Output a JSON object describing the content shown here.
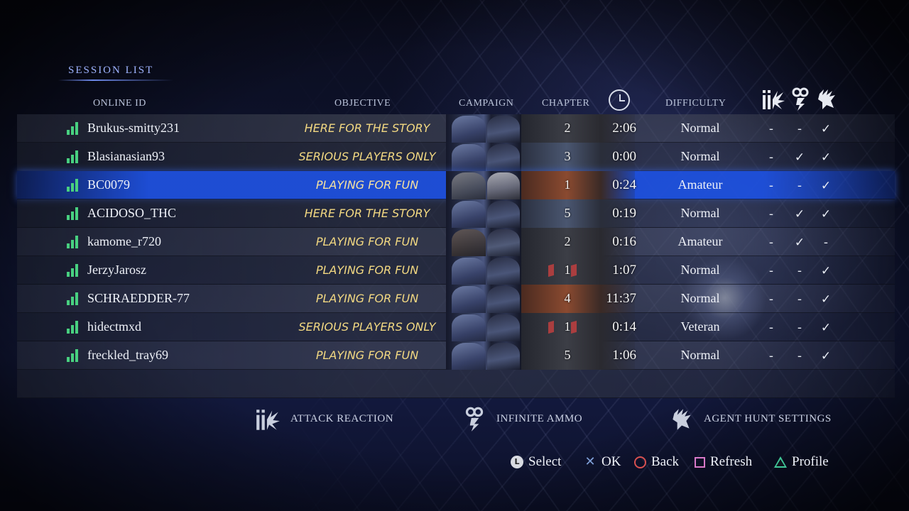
{
  "screen": {
    "title": "SESSION LIST"
  },
  "columns": {
    "online_id": "ONLINE ID",
    "objective": "OBJECTIVE",
    "campaign": "CAMPAIGN",
    "chapter": "CHAPTER",
    "time_icon": "clock-icon",
    "difficulty": "DIFFICULTY",
    "setting_icons": [
      "attack-reaction-icon",
      "infinite-ammo-icon",
      "agent-hunt-icon"
    ]
  },
  "sessions": [
    {
      "online_id": "Brukus-smitty231",
      "objective": "HERE FOR THE STORY",
      "chapter": "2",
      "time": "2:06",
      "difficulty": "Normal",
      "attack_reaction": "-",
      "infinite_ammo": "-",
      "agent_hunt": "✓",
      "signal_bars": 3
    },
    {
      "online_id": "Blasianasian93",
      "objective": "SERIOUS PLAYERS ONLY",
      "chapter": "3",
      "time": "0:00",
      "difficulty": "Normal",
      "attack_reaction": "-",
      "infinite_ammo": "✓",
      "agent_hunt": "✓",
      "signal_bars": 3
    },
    {
      "online_id": "BC0079",
      "objective": "PLAYING FOR FUN",
      "chapter": "1",
      "time": "0:24",
      "difficulty": "Amateur",
      "attack_reaction": "-",
      "infinite_ammo": "-",
      "agent_hunt": "✓",
      "signal_bars": 3,
      "selected": true
    },
    {
      "online_id": "ACIDOSO_THC",
      "objective": "HERE FOR THE STORY",
      "chapter": "5",
      "time": "0:19",
      "difficulty": "Normal",
      "attack_reaction": "-",
      "infinite_ammo": "✓",
      "agent_hunt": "✓",
      "signal_bars": 3
    },
    {
      "online_id": "kamome_r720",
      "objective": "PLAYING FOR FUN",
      "chapter": "2",
      "time": "0:16",
      "difficulty": "Amateur",
      "attack_reaction": "-",
      "infinite_ammo": "✓",
      "agent_hunt": "-",
      "signal_bars": 3
    },
    {
      "online_id": "JerzyJarosz",
      "objective": "PLAYING FOR FUN",
      "chapter": "1",
      "time": "1:07",
      "difficulty": "Normal",
      "attack_reaction": "-",
      "infinite_ammo": "-",
      "agent_hunt": "✓",
      "signal_bars": 3
    },
    {
      "online_id": "SCHRAEDDER-77",
      "objective": "PLAYING FOR FUN",
      "chapter": "4",
      "time": "11:37",
      "difficulty": "Normal",
      "attack_reaction": "-",
      "infinite_ammo": "-",
      "agent_hunt": "✓",
      "signal_bars": 3
    },
    {
      "online_id": "hidectmxd",
      "objective": "SERIOUS PLAYERS ONLY",
      "chapter": "1",
      "time": "0:14",
      "difficulty": "Veteran",
      "attack_reaction": "-",
      "infinite_ammo": "-",
      "agent_hunt": "✓",
      "signal_bars": 3
    },
    {
      "online_id": "freckled_tray69",
      "objective": "PLAYING FOR FUN",
      "chapter": "5",
      "time": "1:06",
      "difficulty": "Normal",
      "attack_reaction": "-",
      "infinite_ammo": "-",
      "agent_hunt": "✓",
      "signal_bars": 3
    }
  ],
  "legend": {
    "attack_reaction": "ATTACK REACTION",
    "infinite_ammo": "INFINITE AMMO",
    "agent_hunt": "AGENT HUNT SETTINGS"
  },
  "controls": [
    {
      "button": "L",
      "icon": "l1-button-icon",
      "label": "Select"
    },
    {
      "button": "cross",
      "icon": "cross-button-icon",
      "label": "OK"
    },
    {
      "button": "circle",
      "icon": "circle-button-icon",
      "label": "Back"
    },
    {
      "button": "square",
      "icon": "square-button-icon",
      "label": "Refresh"
    },
    {
      "button": "triangle",
      "icon": "triangle-button-icon",
      "label": "Profile"
    }
  ],
  "colors": {
    "accent_blue": "#1e50dc",
    "objective_gold": "#f3d982",
    "signal_green": "#48d080",
    "title_blue": "#9fb4ff"
  }
}
